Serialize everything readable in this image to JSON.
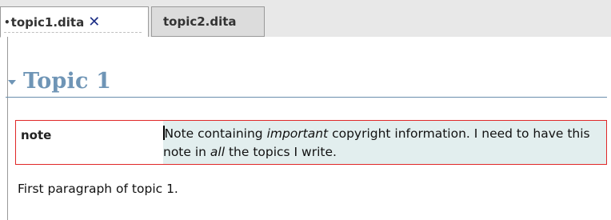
{
  "tabs": [
    {
      "dirty_marker": "•",
      "label": "topic1.dita",
      "close_glyph": "✕",
      "active": true
    },
    {
      "label": "topic2.dita",
      "active": false
    }
  ],
  "document": {
    "title": "Topic 1",
    "note": {
      "label": "note",
      "segments": [
        {
          "text": "Note containing ",
          "style": "normal"
        },
        {
          "text": "important",
          "style": "italic"
        },
        {
          "text": " copyright information. I need to have this note in ",
          "style": "normal"
        },
        {
          "text": "all",
          "style": "italic"
        },
        {
          "text": " the topics I write.",
          "style": "normal"
        }
      ]
    },
    "paragraph": "First paragraph of topic 1."
  },
  "colors": {
    "heading": "#6f95b6",
    "note_border": "#e02828",
    "note_background": "#e2eeee",
    "close_icon": "#1d2f86"
  },
  "icons": {
    "close": "close-icon",
    "collapse": "twisty-icon"
  }
}
